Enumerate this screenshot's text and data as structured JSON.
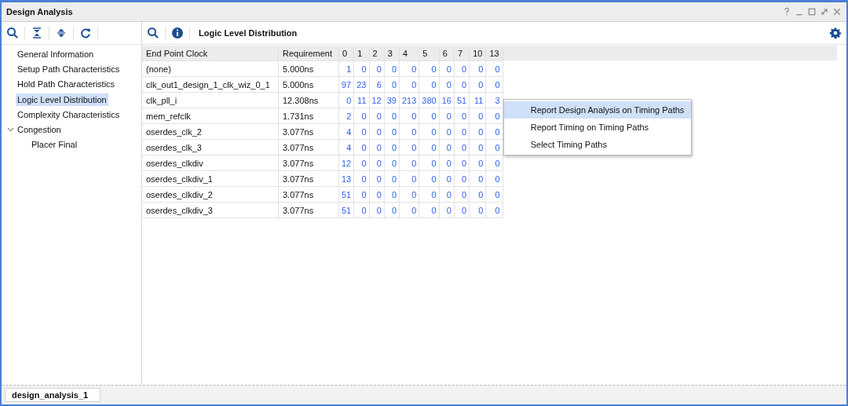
{
  "window": {
    "title": "Design Analysis"
  },
  "tree": [
    {
      "label": "General Information",
      "selected": false
    },
    {
      "label": "Setup Path Characteristics",
      "selected": false
    },
    {
      "label": "Hold Path Characteristics",
      "selected": false
    },
    {
      "label": "Logic Level Distribution",
      "selected": true
    },
    {
      "label": "Complexity Characteristics",
      "selected": false
    },
    {
      "label": "Congestion",
      "selected": false,
      "expanded": true,
      "children": [
        {
          "label": "Placer Final",
          "selected": false
        }
      ]
    }
  ],
  "panel": {
    "title": "Logic Level Distribution"
  },
  "table": {
    "columns": [
      "End Point Clock",
      "Requirement",
      "0",
      "1",
      "2",
      "3",
      "4",
      "5",
      "6",
      "7",
      "10",
      "13"
    ],
    "rows": [
      [
        "(none)",
        "5.000ns",
        "1",
        "0",
        "0",
        "0",
        "0",
        "0",
        "0",
        "0",
        "0",
        "0"
      ],
      [
        "clk_out1_design_1_clk_wiz_0_1",
        "5.000ns",
        "97",
        "23",
        "6",
        "0",
        "0",
        "0",
        "0",
        "0",
        "0",
        "0"
      ],
      [
        "clk_pll_i",
        "12.308ns",
        "0",
        "11",
        "12",
        "39",
        "213",
        "380",
        "16",
        "51",
        "11",
        "3"
      ],
      [
        "mem_refclk",
        "1.731ns",
        "2",
        "0",
        "0",
        "0",
        "0",
        "0",
        "0",
        "0",
        "0",
        "0"
      ],
      [
        "oserdes_clk_2",
        "3.077ns",
        "4",
        "0",
        "0",
        "0",
        "0",
        "0",
        "0",
        "0",
        "0",
        "0"
      ],
      [
        "oserdes_clk_3",
        "3.077ns",
        "4",
        "0",
        "0",
        "0",
        "0",
        "0",
        "0",
        "0",
        "0",
        "0"
      ],
      [
        "oserdes_clkdiv",
        "3.077ns",
        "12",
        "0",
        "0",
        "0",
        "0",
        "0",
        "0",
        "0",
        "0",
        "0"
      ],
      [
        "oserdes_clkdiv_1",
        "3.077ns",
        "13",
        "0",
        "0",
        "0",
        "0",
        "0",
        "0",
        "0",
        "0",
        "0"
      ],
      [
        "oserdes_clkdiv_2",
        "3.077ns",
        "51",
        "0",
        "0",
        "0",
        "0",
        "0",
        "0",
        "0",
        "0",
        "0"
      ],
      [
        "oserdes_clkdiv_3",
        "3.077ns",
        "51",
        "0",
        "0",
        "0",
        "0",
        "0",
        "0",
        "0",
        "0",
        "0"
      ]
    ]
  },
  "context_menu": [
    {
      "label": "Report Design Analysis on Timing Paths",
      "selected": true
    },
    {
      "label": "Report Timing on Timing Paths",
      "selected": false
    },
    {
      "label": "Select Timing Paths",
      "selected": false
    }
  ],
  "bottom_tab": {
    "label": "design_analysis_1"
  }
}
